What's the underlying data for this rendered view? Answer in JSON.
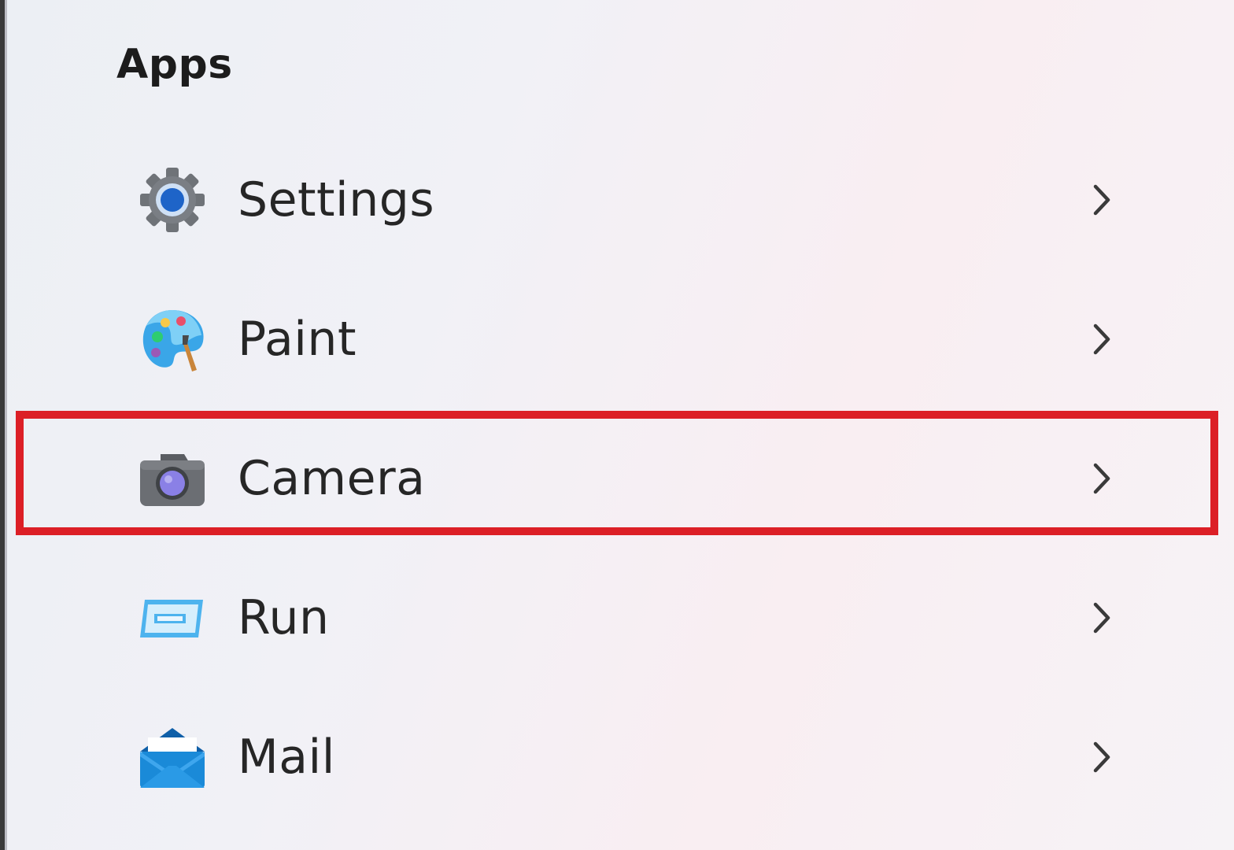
{
  "section": {
    "title": "Apps"
  },
  "apps": [
    {
      "label": "Settings",
      "icon": "settings-gear-icon"
    },
    {
      "label": "Paint",
      "icon": "paint-palette-icon"
    },
    {
      "label": "Camera",
      "icon": "camera-icon"
    },
    {
      "label": "Run",
      "icon": "run-window-icon"
    },
    {
      "label": "Mail",
      "icon": "mail-envelope-icon"
    }
  ],
  "colors": {
    "highlight": "#dc1f26",
    "settings_blue": "#1e64c8",
    "camera_lens": "#8a80e6",
    "mail_blue": "#1a8ad8"
  }
}
